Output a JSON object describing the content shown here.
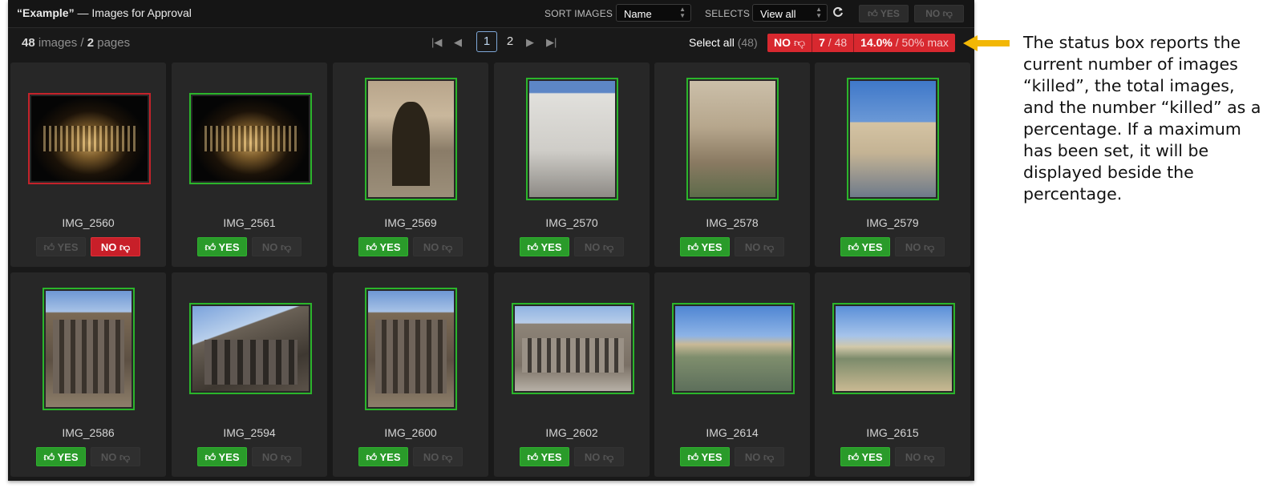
{
  "header": {
    "project": "“Example”",
    "title_suffix": " — Images for Approval",
    "sort_label": "SORT IMAGES :",
    "sort_value": "Name",
    "selects_label": "SELECTS :",
    "selects_value": "View all",
    "yes_label": "YES",
    "no_label": "NO"
  },
  "summary": {
    "image_count": "48",
    "images_word": " images / ",
    "page_count": "2",
    "pages_word": " pages"
  },
  "pagination": {
    "pages": [
      "1",
      "2"
    ],
    "current": "1"
  },
  "select_all": {
    "label": "Select all",
    "count": "(48)"
  },
  "status": {
    "no_label": "NO",
    "killed": "7",
    "total": "/ 48",
    "percent": "14.0%",
    "max": "/ 50% max"
  },
  "images": [
    {
      "name": "IMG_2560",
      "status": "no",
      "photo": "night"
    },
    {
      "name": "IMG_2561",
      "status": "yes",
      "photo": "night"
    },
    {
      "name": "IMG_2569",
      "status": "yes",
      "photo": "arch"
    },
    {
      "name": "IMG_2570",
      "status": "yes",
      "photo": "church"
    },
    {
      "name": "IMG_2578",
      "status": "yes",
      "photo": "fountain"
    },
    {
      "name": "IMG_2579",
      "status": "yes",
      "photo": "piazza"
    },
    {
      "name": "IMG_2586",
      "status": "yes",
      "photo": "col-v"
    },
    {
      "name": "IMG_2594",
      "status": "yes",
      "photo": "col-h"
    },
    {
      "name": "IMG_2600",
      "status": "yes",
      "photo": "col-v"
    },
    {
      "name": "IMG_2602",
      "status": "yes",
      "photo": "pantheon"
    },
    {
      "name": "IMG_2614",
      "status": "yes",
      "photo": "bridge"
    },
    {
      "name": "IMG_2615",
      "status": "yes",
      "photo": "bridge2"
    }
  ],
  "card_buttons": {
    "yes": "YES",
    "no": "NO"
  },
  "annotation": {
    "text": "The status box reports the current number of images “killed”, the total images, and the number “killed” as a percentage. If a maximum has been set, it will be displayed beside the percentage.",
    "arrow_color": "#f2b705"
  },
  "colors": {
    "accept": "#2a9b2a",
    "reject": "#c81f29",
    "status_bg": "#d8282f"
  },
  "icons": {
    "thumb_up": "thumbs-up-icon",
    "thumb_down": "thumbs-down-icon",
    "refresh": "refresh-icon"
  }
}
